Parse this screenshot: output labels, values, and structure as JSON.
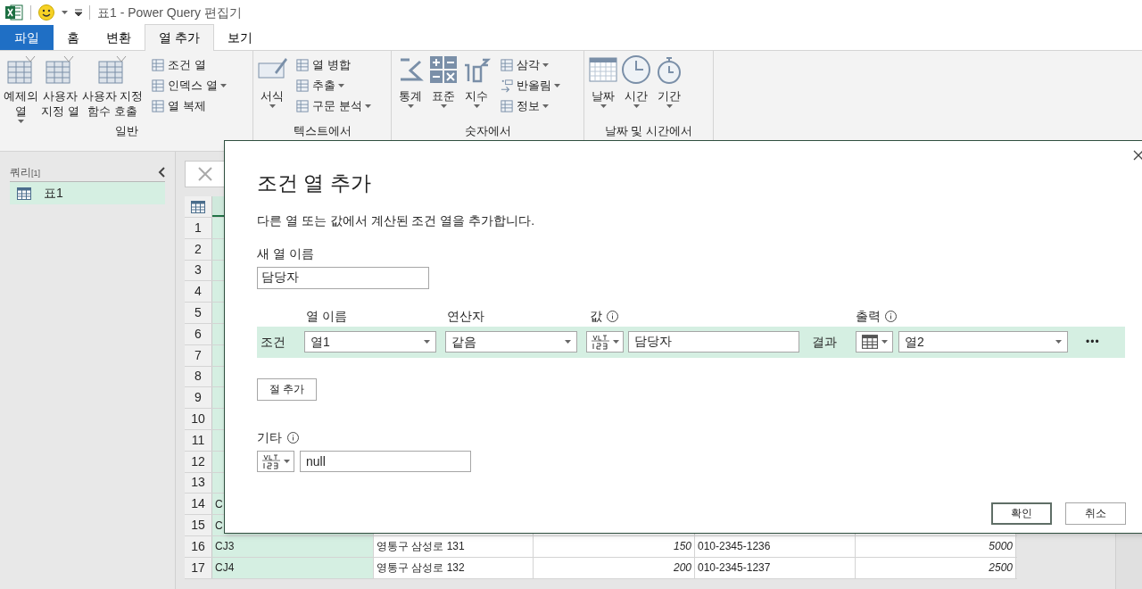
{
  "window": {
    "title": "표1 - Power Query 편집기"
  },
  "tabs": [
    {
      "label": "파일",
      "kind": "file",
      "selected": false
    },
    {
      "label": "홈",
      "kind": "tab",
      "selected": false
    },
    {
      "label": "변환",
      "kind": "tab",
      "selected": false
    },
    {
      "label": "열 추가",
      "kind": "tab",
      "selected": true
    },
    {
      "label": "보기",
      "kind": "tab",
      "selected": false
    }
  ],
  "ribbon": {
    "groups": [
      {
        "label": "일반",
        "large": [
          {
            "label": "예제의\n열",
            "dropdown": true
          },
          {
            "label": "사용자\n지정 열",
            "dropdown": false
          },
          {
            "label": "사용자 지정\n함수 호출",
            "dropdown": false
          }
        ],
        "small": [
          {
            "label": "조건 열",
            "dropdown": false
          },
          {
            "label": "인덱스 열",
            "dropdown": true
          },
          {
            "label": "열 복제",
            "dropdown": false
          }
        ]
      },
      {
        "label": "텍스트에서",
        "large": [
          {
            "label": "서식",
            "dropdown": true
          }
        ],
        "small": [
          {
            "label": "열 병합",
            "dropdown": false
          },
          {
            "label": "추출",
            "dropdown": true
          },
          {
            "label": "구문 분석",
            "dropdown": true
          }
        ]
      },
      {
        "label": "숫자에서",
        "large": [
          {
            "label": "통계",
            "dropdown": true
          },
          {
            "label": "표준",
            "dropdown": true
          },
          {
            "label": "지수",
            "dropdown": true
          }
        ],
        "small": [
          {
            "label": "삼각",
            "dropdown": true
          },
          {
            "label": "반올림",
            "dropdown": true
          },
          {
            "label": "정보",
            "dropdown": true
          }
        ]
      },
      {
        "label": "날짜 및 시간에서",
        "large": [
          {
            "label": "날짜",
            "dropdown": true
          },
          {
            "label": "시간",
            "dropdown": true
          },
          {
            "label": "기간",
            "dropdown": true
          }
        ]
      }
    ]
  },
  "queries": {
    "title": "쿼리",
    "count": "[1]",
    "items": [
      {
        "label": "표1",
        "selected": true
      }
    ]
  },
  "table": {
    "rows": [
      {
        "n": "1",
        "cells": []
      },
      {
        "n": "2",
        "cells": []
      },
      {
        "n": "3",
        "cells": []
      },
      {
        "n": "4",
        "cells": []
      },
      {
        "n": "5",
        "cells": []
      },
      {
        "n": "6",
        "cells": []
      },
      {
        "n": "7",
        "cells": []
      },
      {
        "n": "8",
        "cells": []
      },
      {
        "n": "9",
        "cells": []
      },
      {
        "n": "10",
        "cells": []
      },
      {
        "n": "11",
        "cells": []
      },
      {
        "n": "12",
        "cells": []
      },
      {
        "n": "13",
        "cells": []
      },
      {
        "n": "14",
        "cells": [
          "C"
        ]
      },
      {
        "n": "15",
        "cells": [
          "C"
        ]
      },
      {
        "n": "16",
        "cells": [
          "CJ3",
          "영통구 삼성로 131",
          "150",
          "010-2345-1236",
          "5000"
        ]
      },
      {
        "n": "17",
        "cells": [
          "CJ4",
          "영통구 삼성로 132",
          "200",
          "010-2345-1237",
          "2500"
        ]
      }
    ]
  },
  "dialog": {
    "title": "조건 열 추가",
    "description": "다른 열 또는 값에서 계산된 조건 열을 추가합니다.",
    "new_column_label": "새 열 이름",
    "new_column_value": "담당자",
    "headers": [
      "열 이름",
      "연산자",
      "값",
      "출력"
    ],
    "condition": {
      "label": "조건",
      "column": "열1",
      "operator": "같음",
      "value": "담당자",
      "result_label": "결과",
      "output": "열2",
      "more": "•••"
    },
    "add_clause": "절 추가",
    "else_label": "기타",
    "else_value": "null",
    "ok": "확인",
    "cancel": "취소"
  }
}
